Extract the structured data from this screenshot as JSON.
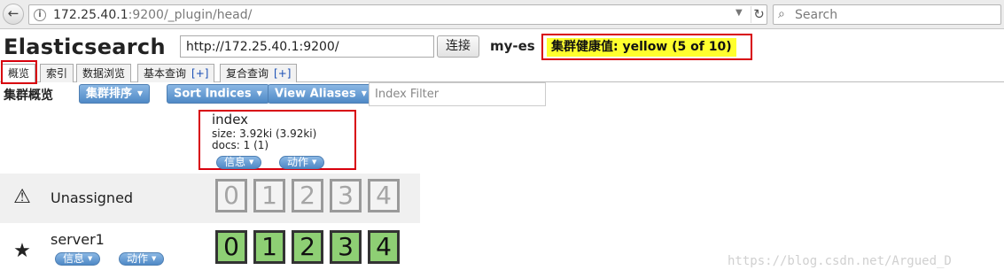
{
  "browser": {
    "url_host": "172.25.40.1",
    "url_rest": ":9200/_plugin/head/",
    "search_placeholder": "Search"
  },
  "header": {
    "title": "Elasticsearch",
    "connection_url": "http://172.25.40.1:9200/",
    "connect_label": "连接",
    "cluster_name": "my-es",
    "health_text": "集群健康值: yellow (5 of 10)",
    "health_color": "#ffff2e"
  },
  "tabs": [
    {
      "label": "概览",
      "plus": ""
    },
    {
      "label": "索引",
      "plus": ""
    },
    {
      "label": "数据浏览",
      "plus": ""
    },
    {
      "label": "基本查询",
      "plus": "[+]"
    },
    {
      "label": "复合查询",
      "plus": "[+]"
    }
  ],
  "toolbar": {
    "section_title": "集群概览",
    "sort_cluster_label": "集群排序",
    "sort_indices_label": "Sort Indices",
    "view_aliases_label": "View Aliases",
    "index_filter_placeholder": "Index Filter"
  },
  "index": {
    "name": "index",
    "size": "size: 3.92ki (3.92ki)",
    "docs": "docs: 1 (1)",
    "info_label": "信息",
    "action_label": "动作"
  },
  "unassigned": {
    "icon": "warning-icon",
    "label": "Unassigned",
    "shards": [
      "0",
      "1",
      "2",
      "3",
      "4"
    ]
  },
  "node": {
    "icon": "star-icon",
    "name": "server1",
    "info_label": "信息",
    "action_label": "动作",
    "shards": [
      "0",
      "1",
      "2",
      "3",
      "4"
    ]
  },
  "colors": {
    "accent_blue": "#4f89c6",
    "shard_started": "#8ecf74",
    "highlight_red": "#d8000c"
  },
  "watermark": "https://blog.csdn.net/Argued_D"
}
